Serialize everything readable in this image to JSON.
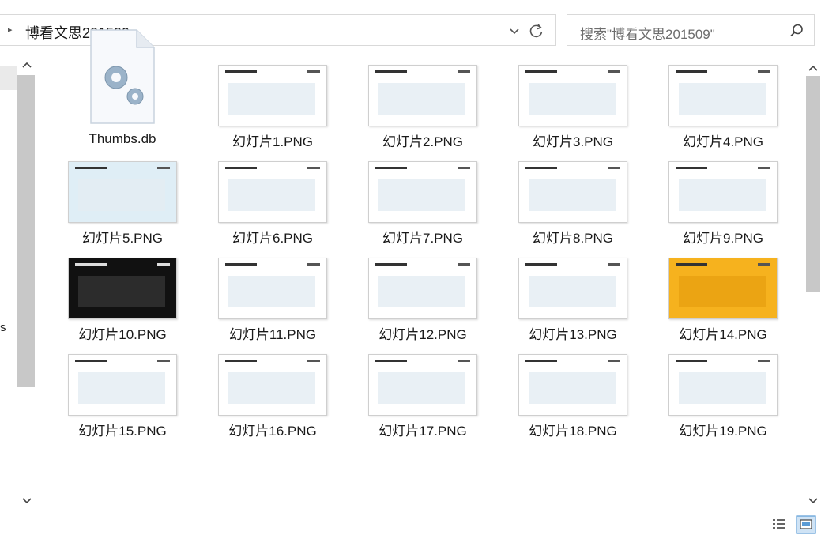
{
  "address": {
    "path": "博看文思201509",
    "search_placeholder": "搜索\"博看文思201509\""
  },
  "left_pane": {
    "fragment": "s"
  },
  "files": [
    {
      "name": "Thumbs.db",
      "kind": "db"
    },
    {
      "name": "幻灯片1.PNG",
      "kind": "slide",
      "bg": "#ffffff"
    },
    {
      "name": "幻灯片2.PNG",
      "kind": "slide",
      "bg": "#ffffff"
    },
    {
      "name": "幻灯片3.PNG",
      "kind": "slide",
      "bg": "#ffffff"
    },
    {
      "name": "幻灯片4.PNG",
      "kind": "slide",
      "bg": "#ffffff"
    },
    {
      "name": "幻灯片5.PNG",
      "kind": "slide",
      "bg": "#dfeef6"
    },
    {
      "name": "幻灯片6.PNG",
      "kind": "slide",
      "bg": "#ffffff"
    },
    {
      "name": "幻灯片7.PNG",
      "kind": "slide",
      "bg": "#ffffff"
    },
    {
      "name": "幻灯片8.PNG",
      "kind": "slide",
      "bg": "#ffffff"
    },
    {
      "name": "幻灯片9.PNG",
      "kind": "slide",
      "bg": "#ffffff"
    },
    {
      "name": "幻灯片10.PNG",
      "kind": "slide",
      "bg": "#111111"
    },
    {
      "name": "幻灯片11.PNG",
      "kind": "slide",
      "bg": "#ffffff"
    },
    {
      "name": "幻灯片12.PNG",
      "kind": "slide",
      "bg": "#ffffff"
    },
    {
      "name": "幻灯片13.PNG",
      "kind": "slide",
      "bg": "#ffffff"
    },
    {
      "name": "幻灯片14.PNG",
      "kind": "slide",
      "bg": "#f6b21e"
    },
    {
      "name": "幻灯片15.PNG",
      "kind": "slide",
      "bg": "#ffffff"
    },
    {
      "name": "幻灯片16.PNG",
      "kind": "slide",
      "bg": "#ffffff"
    },
    {
      "name": "幻灯片17.PNG",
      "kind": "slide",
      "bg": "#ffffff"
    },
    {
      "name": "幻灯片18.PNG",
      "kind": "slide",
      "bg": "#ffffff"
    },
    {
      "name": "幻灯片19.PNG",
      "kind": "slide",
      "bg": "#ffffff"
    }
  ],
  "icons": {
    "dropdown": "chevron-down-icon",
    "refresh": "refresh-icon",
    "search": "search-icon",
    "details_view": "details-view-icon",
    "large_icons_view": "large-icons-view-icon"
  }
}
